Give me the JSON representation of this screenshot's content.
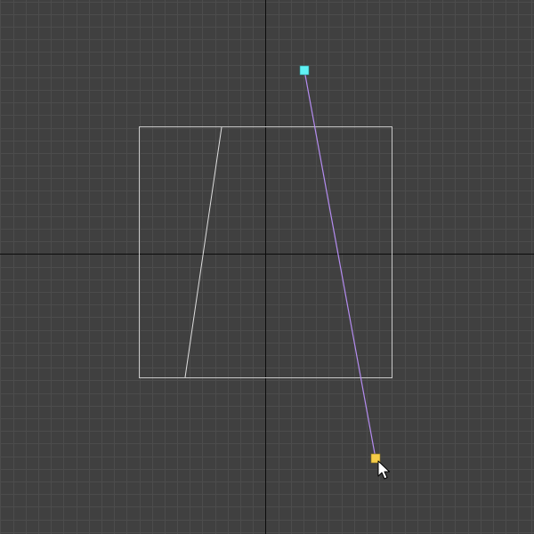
{
  "viewport": {
    "view": "2d-orthographic",
    "background_color": "#404040",
    "grid_color": "#4c4c4c",
    "axis_color": "#0b0b0b",
    "grid_visible": true
  },
  "scene": {
    "frame_color": "#c8c8c8",
    "inner_line_color": "#dedede",
    "gradient_line_color": "#b48cf0"
  },
  "handles": {
    "start": {
      "color": "#5ff2f5",
      "icon": "square-handle"
    },
    "end": {
      "color": "#f5cc48",
      "icon": "square-handle"
    }
  },
  "cursor": {
    "icon": "arrow-cursor-icon"
  }
}
